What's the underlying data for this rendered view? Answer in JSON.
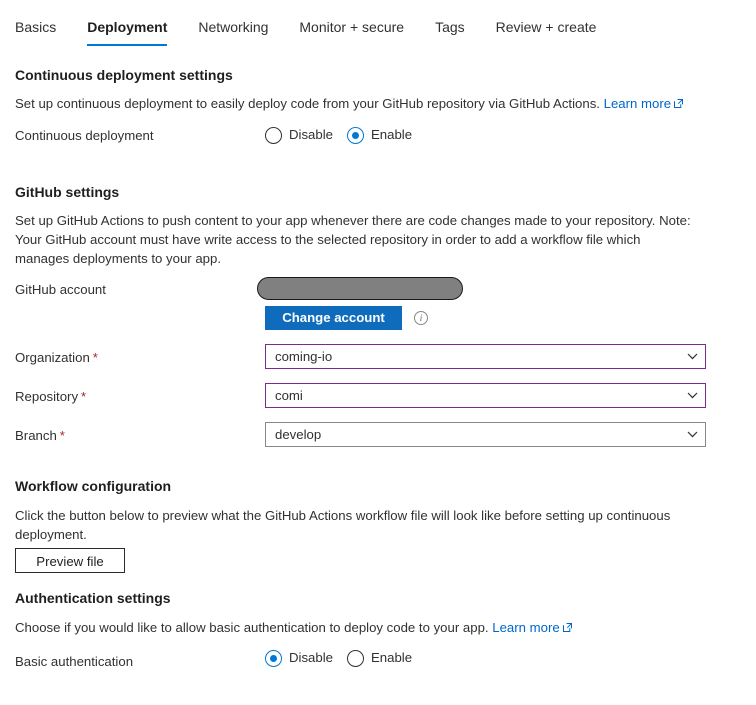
{
  "tabs": [
    {
      "label": "Basics",
      "active": false
    },
    {
      "label": "Deployment",
      "active": true
    },
    {
      "label": "Networking",
      "active": false
    },
    {
      "label": "Monitor + secure",
      "active": false
    },
    {
      "label": "Tags",
      "active": false
    },
    {
      "label": "Review + create",
      "active": false
    }
  ],
  "continuous_deployment": {
    "section_title": "Continuous deployment settings",
    "description": "Set up continuous deployment to easily deploy code from your GitHub repository via GitHub Actions.",
    "learn_more": "Learn more",
    "row_label": "Continuous deployment",
    "options": [
      {
        "label": "Disable",
        "selected": false
      },
      {
        "label": "Enable",
        "selected": true
      }
    ]
  },
  "github_settings": {
    "section_title": "GitHub settings",
    "description": "Set up GitHub Actions to push content to your app whenever there are code changes made to your repository. Note: Your GitHub account must have write access to the selected repository in order to add a workflow file which manages deployments to your app.",
    "account_label": "GitHub account",
    "account_value": "",
    "change_account_button": "Change account",
    "info_icon_glyph": "i",
    "fields": [
      {
        "label": "Organization",
        "required": true,
        "value": "coming-io",
        "visited": true
      },
      {
        "label": "Repository",
        "required": true,
        "value": "comi",
        "visited": true
      },
      {
        "label": "Branch",
        "required": true,
        "value": "develop",
        "visited": false
      }
    ]
  },
  "workflow_configuration": {
    "section_title": "Workflow configuration",
    "description": "Click the button below to preview what the GitHub Actions workflow file will look like before setting up continuous deployment.",
    "preview_button": "Preview file"
  },
  "authentication_settings": {
    "section_title": "Authentication settings",
    "description": "Choose if you would like to allow basic authentication to deploy code to your app.",
    "learn_more": "Learn more",
    "row_label": "Basic authentication",
    "options": [
      {
        "label": "Disable",
        "selected": true
      },
      {
        "label": "Enable",
        "selected": false
      }
    ]
  },
  "colors": {
    "accent": "#0078d4",
    "primary_button": "#0f6cbd",
    "link": "#0066cc",
    "required_asterisk": "#a4262c",
    "visited_border": "#7b2d8e",
    "redaction": "#808080"
  }
}
